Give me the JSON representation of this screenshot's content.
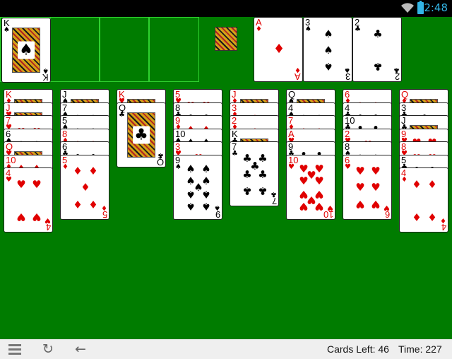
{
  "status_bar": {
    "time": "2:48"
  },
  "bottom_bar": {
    "cards_left": "Cards Left: 46",
    "time": "Time: 227"
  },
  "colors": {
    "felt": "#007c00",
    "slot_border": "#2fd22f",
    "red_suit": "#e00000",
    "black_suit": "#000000",
    "clock": "#33b5e5"
  },
  "icons": [
    "wifi-icon",
    "battery-icon",
    "menu-icon",
    "restart-icon",
    "undo-back-icon",
    "king-status-icon"
  ],
  "free_cells": [
    {
      "rank": "K",
      "suit": "♠",
      "color": "black"
    },
    null,
    null,
    null
  ],
  "foundations": [
    {
      "rank": "A",
      "suit": "♦",
      "color": "red"
    },
    {
      "rank": "3",
      "suit": "♠",
      "color": "black"
    },
    {
      "rank": "2",
      "suit": "♣",
      "color": "black"
    }
  ],
  "tableau": [
    [
      {
        "rank": "K",
        "suit": "♦",
        "color": "red"
      },
      {
        "rank": "J",
        "suit": "♥",
        "color": "red"
      },
      {
        "rank": "7",
        "suit": "♥",
        "color": "red"
      },
      {
        "rank": "6",
        "suit": "♠",
        "color": "black"
      },
      {
        "rank": "Q",
        "suit": "♥",
        "color": "red"
      },
      {
        "rank": "10",
        "suit": "♦",
        "color": "red"
      },
      {
        "rank": "4",
        "suit": "♥",
        "color": "red"
      }
    ],
    [
      {
        "rank": "J",
        "suit": "♠",
        "color": "black"
      },
      {
        "rank": "7",
        "suit": "♠",
        "color": "black"
      },
      {
        "rank": "5",
        "suit": "♠",
        "color": "black"
      },
      {
        "rank": "8",
        "suit": "♦",
        "color": "red"
      },
      {
        "rank": "6",
        "suit": "♣",
        "color": "black"
      },
      {
        "rank": "5",
        "suit": "♦",
        "color": "red"
      }
    ],
    [
      {
        "rank": "K",
        "suit": "♥",
        "color": "red"
      },
      {
        "rank": "Q",
        "suit": "♣",
        "color": "black"
      }
    ],
    [
      {
        "rank": "5",
        "suit": "♥",
        "color": "red"
      },
      {
        "rank": "8",
        "suit": "♣",
        "color": "black"
      },
      {
        "rank": "9",
        "suit": "♦",
        "color": "red"
      },
      {
        "rank": "10",
        "suit": "♠",
        "color": "black"
      },
      {
        "rank": "3",
        "suit": "♥",
        "color": "red"
      },
      {
        "rank": "9",
        "suit": "♠",
        "color": "black"
      }
    ],
    [
      {
        "rank": "J",
        "suit": "♦",
        "color": "red"
      },
      {
        "rank": "3",
        "suit": "♦",
        "color": "red"
      },
      {
        "rank": "2",
        "suit": "♦",
        "color": "red"
      },
      {
        "rank": "K",
        "suit": "♣",
        "color": "black"
      },
      {
        "rank": "7",
        "suit": "♣",
        "color": "black"
      }
    ],
    [
      {
        "rank": "Q",
        "suit": "♠",
        "color": "black"
      },
      {
        "rank": "4",
        "suit": "♠",
        "color": "black"
      },
      {
        "rank": "7",
        "suit": "♦",
        "color": "red"
      },
      {
        "rank": "A",
        "suit": "♥",
        "color": "red"
      },
      {
        "rank": "9",
        "suit": "♣",
        "color": "black"
      },
      {
        "rank": "10",
        "suit": "♥",
        "color": "red"
      }
    ],
    [
      {
        "rank": "6",
        "suit": "♦",
        "color": "red"
      },
      {
        "rank": "4",
        "suit": "♣",
        "color": "black"
      },
      {
        "rank": "10",
        "suit": "♣",
        "color": "black"
      },
      {
        "rank": "2",
        "suit": "♥",
        "color": "red"
      },
      {
        "rank": "8",
        "suit": "♠",
        "color": "black"
      },
      {
        "rank": "6",
        "suit": "♥",
        "color": "red"
      }
    ],
    [
      {
        "rank": "Q",
        "suit": "♦",
        "color": "red"
      },
      {
        "rank": "3",
        "suit": "♣",
        "color": "black"
      },
      {
        "rank": "J",
        "suit": "♣",
        "color": "black"
      },
      {
        "rank": "9",
        "suit": "♥",
        "color": "red"
      },
      {
        "rank": "8",
        "suit": "♥",
        "color": "red"
      },
      {
        "rank": "5",
        "suit": "♣",
        "color": "black"
      },
      {
        "rank": "4",
        "suit": "♦",
        "color": "red"
      }
    ]
  ]
}
